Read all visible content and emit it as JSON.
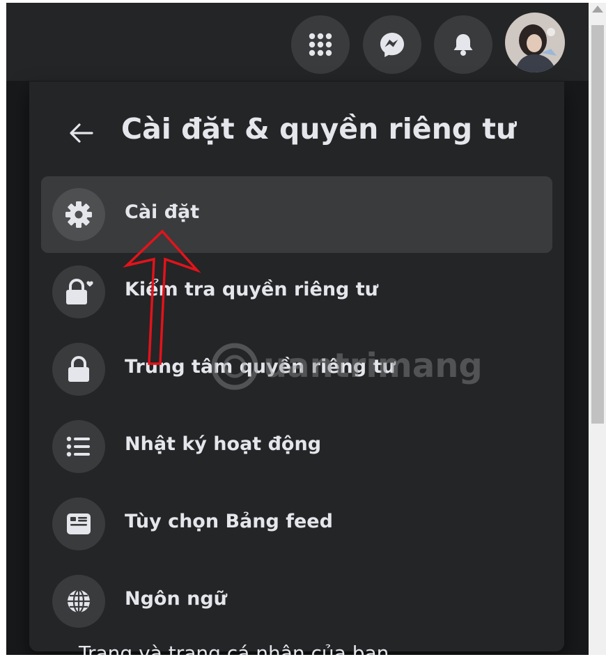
{
  "header": {
    "buttons": [
      {
        "name": "menu",
        "icon": "grid-dots-icon"
      },
      {
        "name": "messenger",
        "icon": "messenger-icon"
      },
      {
        "name": "notifications",
        "icon": "bell-icon"
      }
    ],
    "avatar_icon": "profile-photo"
  },
  "panel": {
    "back_icon": "arrow-left-icon",
    "title": "Cài đặt & quyền riêng tư",
    "items": [
      {
        "label": "Cài đặt",
        "icon": "gear-icon",
        "active": true
      },
      {
        "label": "Kiểm tra quyền riêng tư",
        "icon": "lock-heart-icon"
      },
      {
        "label": "Trung tâm quyền riêng tư",
        "icon": "lock-icon"
      },
      {
        "label": "Nhật ký hoạt động",
        "icon": "list-icon"
      },
      {
        "label": "Tùy chọn Bảng feed",
        "icon": "feed-icon"
      },
      {
        "label": "Ngôn ngữ",
        "icon": "globe-icon"
      }
    ]
  },
  "background_text": "Trang và trang cá nhân của bạn",
  "watermark": {
    "text": "uantrimang"
  },
  "annotation": {
    "arrow_color": "#e2131b"
  },
  "colors": {
    "background": "#18191a",
    "panel": "#242526",
    "hover": "#3a3b3c",
    "text": "#e4e6eb"
  }
}
